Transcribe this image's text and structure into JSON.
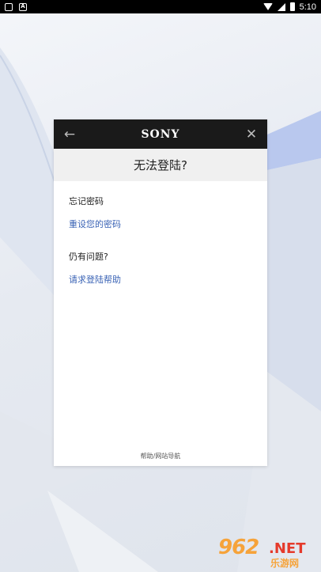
{
  "status_bar": {
    "left_icons": [
      "shield-icon",
      "a-icon"
    ],
    "right_icons": [
      "wifi-icon",
      "signal-icon",
      "battery-icon"
    ],
    "icon_glyph_a": "A",
    "time": "5:10"
  },
  "header": {
    "back_icon": "arrow-left-icon",
    "brand": "SONY",
    "close_icon": "close-icon"
  },
  "page": {
    "title": "无法登陆?"
  },
  "sections": [
    {
      "label": "忘记密码",
      "link": "重设您的密码"
    },
    {
      "label": "仍有问题?",
      "link": "请求登陆帮助"
    }
  ],
  "footer": {
    "text": "帮助/网站导航"
  },
  "watermark": {
    "number": "962",
    "net": ".NET",
    "cn": "乐游网"
  },
  "colors": {
    "header_bg": "#1a1a1a",
    "link": "#3a63b5",
    "title_bar_bg": "#f0f0f0",
    "accent_blue": "#b7c6ec"
  }
}
